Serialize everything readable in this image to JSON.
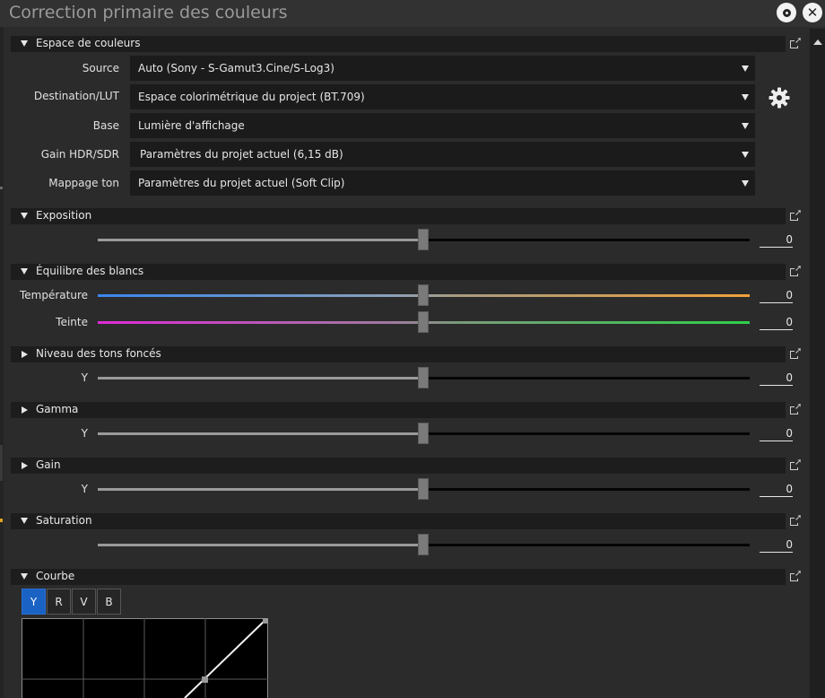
{
  "window": {
    "title": "Correction primaire des couleurs"
  },
  "color_space": {
    "title": "Espace de couleurs",
    "source": {
      "label": "Source",
      "value": "Auto (Sony - S-Gamut3.Cine/S-Log3)"
    },
    "destination": {
      "label": "Destination/LUT",
      "value": "Espace colorimétrique du project (BT.709)"
    },
    "base": {
      "label": "Base",
      "value": "Lumière d'affichage"
    },
    "gain": {
      "label": "Gain HDR/SDR",
      "value": "Paramètres du projet actuel (6,15 dB)"
    },
    "tone_mapping": {
      "label": "Mappage ton",
      "value": "Paramètres du projet actuel (Soft Clip)"
    }
  },
  "exposure": {
    "title": "Exposition",
    "value": "0"
  },
  "white_balance": {
    "title": "Équilibre des blancs",
    "temperature": {
      "label": "Température",
      "value": "0"
    },
    "tint": {
      "label": "Teinte",
      "value": "0"
    }
  },
  "shadows": {
    "title": "Niveau des tons foncés",
    "label": "Y",
    "value": "0"
  },
  "gamma": {
    "title": "Gamma",
    "label": "Y",
    "value": "0"
  },
  "gain_section": {
    "title": "Gain",
    "label": "Y",
    "value": "0"
  },
  "saturation": {
    "title": "Saturation",
    "value": "0"
  },
  "curve": {
    "title": "Courbe",
    "tabs": [
      "Y",
      "R",
      "V",
      "B"
    ],
    "active_tab": "Y"
  },
  "icons": {
    "window": [
      "settings-icon",
      "close-icon"
    ],
    "sections": [
      "collapse-triangle-icon",
      "expand-triangle-icon",
      "reset-icon"
    ],
    "gear": "gear-icon"
  },
  "colors": {
    "accent": "#1a62c4",
    "temp_cold": "#3a86ee",
    "temp_warm": "#f0a23a",
    "tint_magenta": "#e02ad8",
    "tint_green": "#2ed04a"
  }
}
